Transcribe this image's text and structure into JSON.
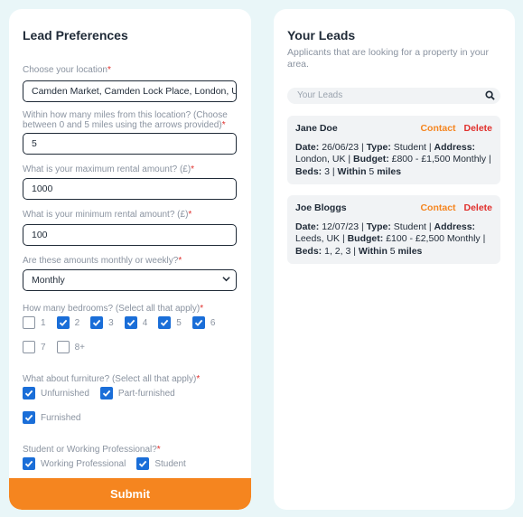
{
  "left": {
    "title": "Lead Preferences",
    "location_label": "Choose your location",
    "location_value": "Camden Market, Camden Lock Place, London, UK",
    "miles_label": "Within how many miles from this location? (Choose between 0 and 5 miles using the arrows provided)",
    "miles_value": "5",
    "max_label": "What is your maximum rental amount? (£)",
    "max_value": "1000",
    "min_label": "What is your minimum rental amount? (£)",
    "min_value": "100",
    "frequency_label": "Are these amounts monthly or weekly?",
    "frequency_value": "Monthly",
    "bedrooms_label": "How many bedrooms? (Select all that apply)",
    "bedrooms": [
      {
        "label": "1",
        "checked": false
      },
      {
        "label": "2",
        "checked": true
      },
      {
        "label": "3",
        "checked": true
      },
      {
        "label": "4",
        "checked": true
      },
      {
        "label": "5",
        "checked": true
      },
      {
        "label": "6",
        "checked": true
      },
      {
        "label": "7",
        "checked": false
      },
      {
        "label": "8+",
        "checked": false
      }
    ],
    "furniture_label": "What about furniture? (Select all that apply)",
    "furniture": [
      {
        "label": "Unfurnished",
        "checked": true
      },
      {
        "label": "Part-furnished",
        "checked": true
      },
      {
        "label": "Furnished",
        "checked": true
      }
    ],
    "occupation_label": "Student or Working Professional?",
    "occupation": [
      {
        "label": "Working Professional",
        "checked": true
      },
      {
        "label": "Student",
        "checked": true
      }
    ],
    "required_mark": "*",
    "submit_label": "Submit"
  },
  "right": {
    "title": "Your Leads",
    "subtitle": "Applicants that are looking for a property in your area.",
    "search_placeholder": "Your Leads",
    "contact_label": "Contact",
    "delete_label": "Delete",
    "leads": [
      {
        "name": "Jane Doe",
        "date": "26/06/23",
        "type": "Student",
        "address": "London, UK",
        "budget": "£800 - £1,500 Monthly",
        "beds": "3",
        "within": "5"
      },
      {
        "name": "Joe Bloggs",
        "date": "12/07/23",
        "type": "Student",
        "address": "Leeds, UK",
        "budget": "£100 - £2,500 Monthly",
        "beds": "1, 2, 3",
        "within": "5"
      }
    ],
    "labels": {
      "date": "Date:",
      "type": "Type:",
      "address": "Address:",
      "budget": "Budget:",
      "beds": "Beds:",
      "within": "Within",
      "miles": "miles"
    }
  },
  "colors": {
    "background": "#e9f6f8",
    "accent_orange": "#f5851f",
    "checkbox_blue": "#1a6ed8",
    "required_red": "#e0302d"
  }
}
